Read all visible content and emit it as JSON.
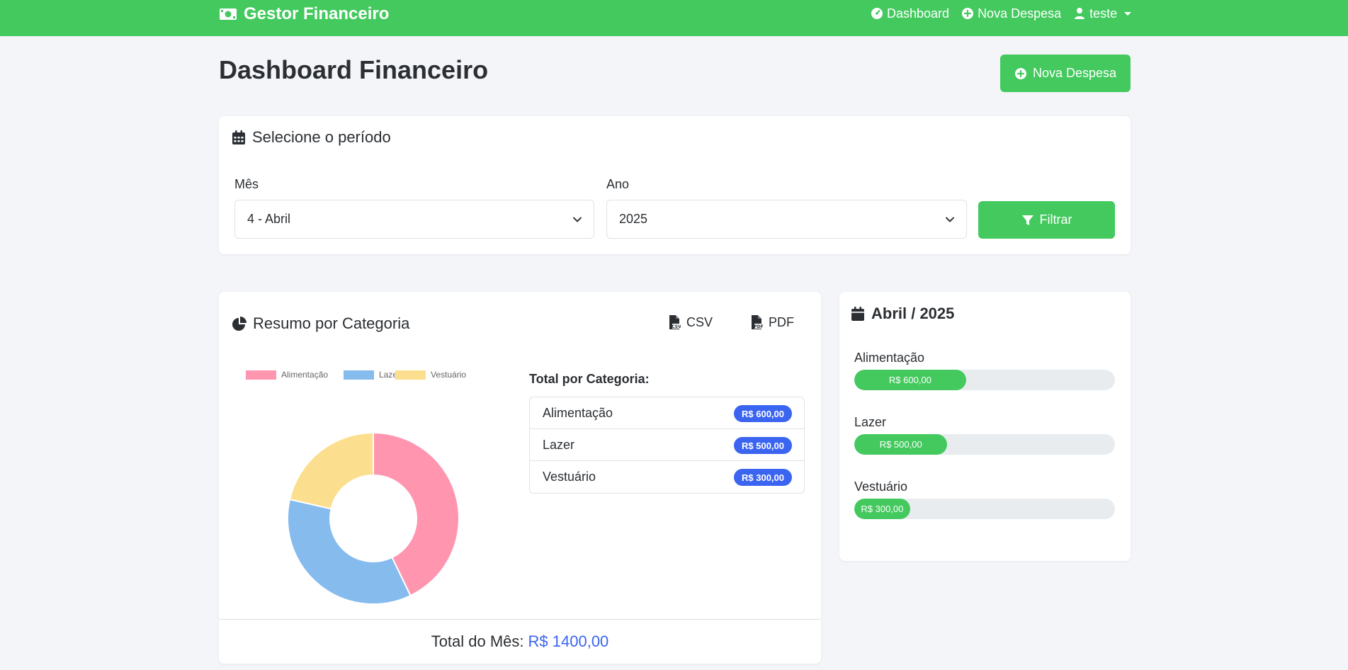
{
  "navbar": {
    "brand": "Gestor Financeiro",
    "links": [
      "Dashboard",
      "Nova Despesa"
    ],
    "user": "teste"
  },
  "page": {
    "title": "Dashboard Financeiro",
    "new_button": "Nova Despesa"
  },
  "period": {
    "title": "Selecione o período",
    "month_label": "Mês",
    "month_value": "4 - Abril",
    "year_label": "Ano",
    "year_value": "2025",
    "filter_button": "Filtrar"
  },
  "summary": {
    "title": "Resumo por Categoria",
    "export_csv": "CSV",
    "export_pdf": "PDF",
    "list_title": "Total por Categoria:",
    "items": [
      {
        "name": "Alimentação",
        "value": "R$ 600,00"
      },
      {
        "name": "Lazer",
        "value": "R$ 500,00"
      },
      {
        "name": "Vestuário",
        "value": "R$ 300,00"
      }
    ],
    "total_label": "Total do Mês:",
    "total_value": "R$ 1400,00"
  },
  "chart_data": {
    "type": "pie",
    "variant": "doughnut",
    "categories": [
      "Alimentação",
      "Lazer",
      "Vestuário"
    ],
    "values": [
      600,
      500,
      300
    ],
    "colors": [
      "#ff95ae",
      "#86bbee",
      "#fcdf8e"
    ],
    "legend_position": "top"
  },
  "monthly": {
    "title": "Abril / 2025",
    "items": [
      {
        "name": "Alimentação",
        "value": "R$ 600,00",
        "share": 0.429
      },
      {
        "name": "Lazer",
        "value": "R$ 500,00",
        "share": 0.357
      },
      {
        "name": "Vestuário",
        "value": "R$ 300,00",
        "share": 0.214
      }
    ]
  },
  "colors": {
    "primary": "#43c95e",
    "accent": "#3b64f1",
    "background": "#f4f5f9"
  },
  "icons": {
    "brand": "money-bill-icon",
    "dashboard": "gauge-icon",
    "new": "plus-circle-icon",
    "user": "user-icon",
    "calendar": "calendar-icon",
    "filter": "filter-icon",
    "pie": "pie-chart-icon",
    "csv": "csv-file-icon",
    "pdf": "pdf-file-icon"
  }
}
